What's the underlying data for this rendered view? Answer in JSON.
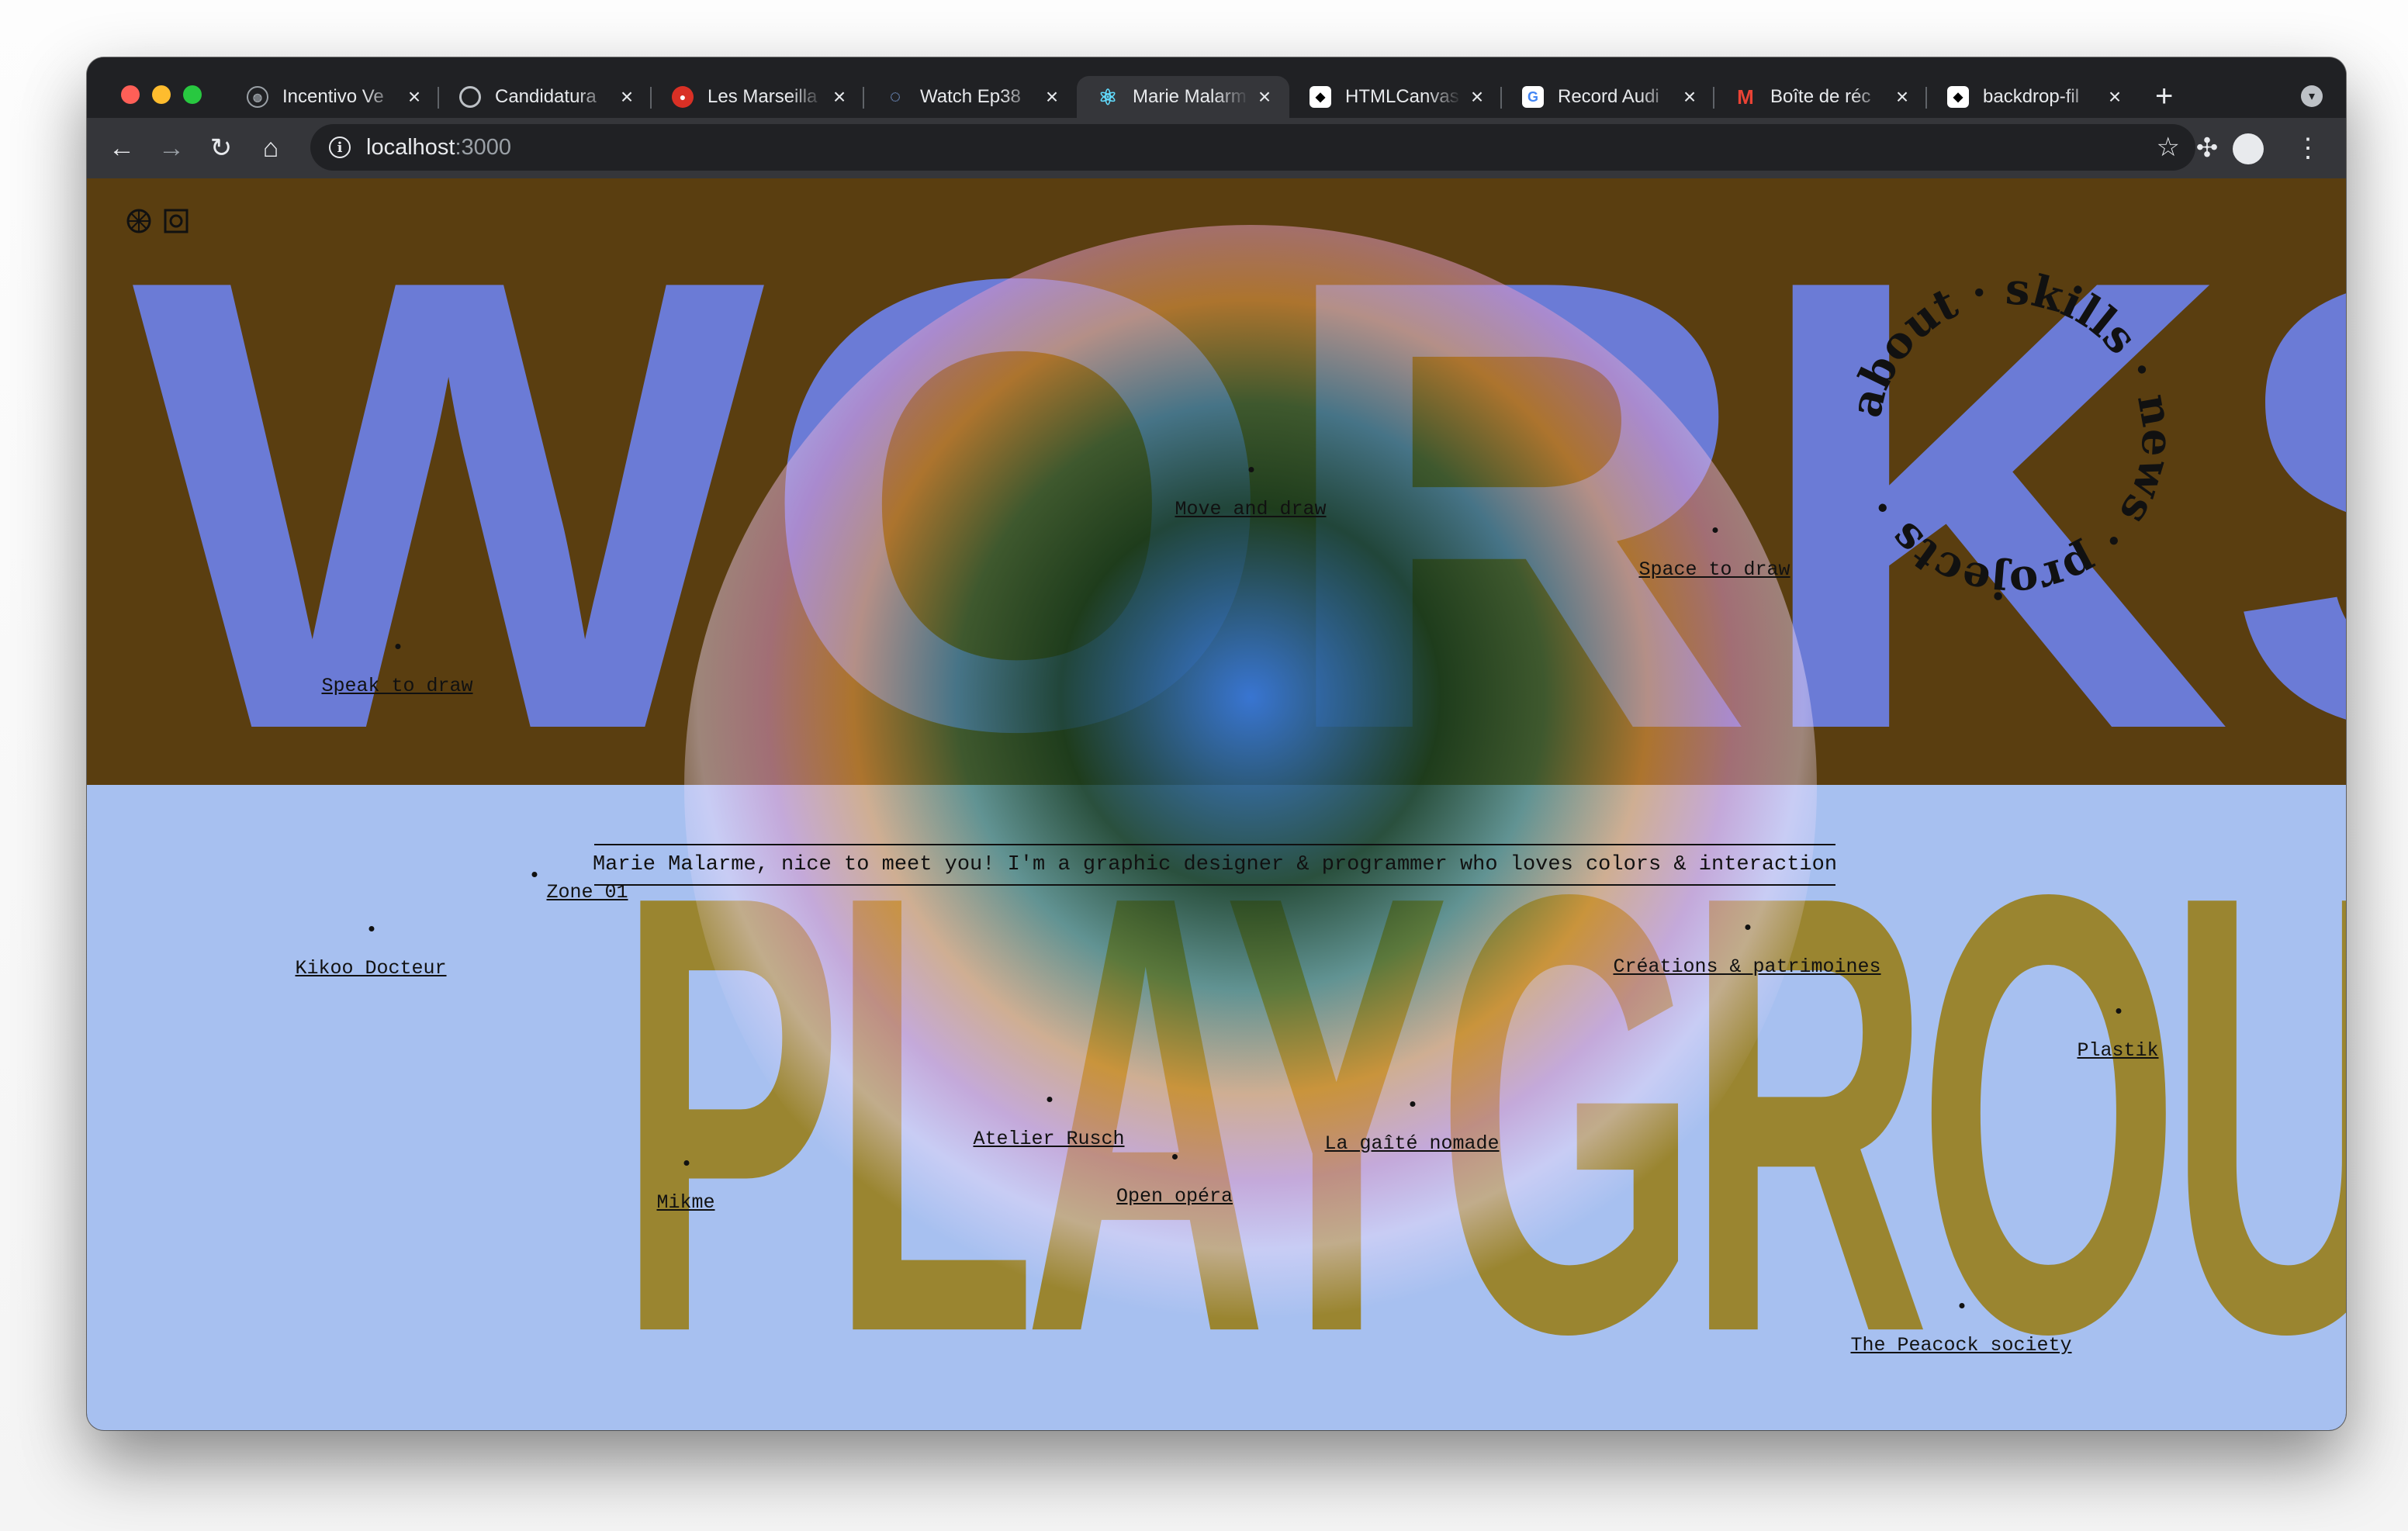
{
  "browser": {
    "tabs": [
      {
        "title": "Incentivo Ve",
        "favicon": "globe-icon",
        "active": false
      },
      {
        "title": "Candidatura",
        "favicon": "app-icon",
        "active": false
      },
      {
        "title": "Les Marseilla",
        "favicon": "record-icon",
        "active": false
      },
      {
        "title": "Watch Ep38",
        "favicon": "spinner-icon",
        "active": false
      },
      {
        "title": "Marie Malarm",
        "favicon": "react-icon",
        "active": true
      },
      {
        "title": "HTMLCanvas",
        "favicon": "mdn-icon",
        "active": false
      },
      {
        "title": "Record Audi",
        "favicon": "google-icon",
        "active": false
      },
      {
        "title": "Boîte de réc",
        "favicon": "gmail-icon",
        "active": false
      },
      {
        "title": "backdrop-fil",
        "favicon": "mdn-icon",
        "active": false
      }
    ],
    "url_host": "localhost",
    "url_port": ":3000",
    "colors": {
      "chrome_dark": "#202124",
      "chrome_toolbar": "#35363a"
    }
  },
  "page": {
    "headline_top": "WORKS",
    "headline_bottom": "PLAYGROUND",
    "tagline": "Marie Malarme, nice to meet you! I'm a graphic designer & programmer who loves colors & interaction",
    "nav_circle": "about · skills · news · projects ·",
    "works_links": [
      {
        "label": "Speak to draw"
      },
      {
        "label": "Move and draw"
      },
      {
        "label": "Space to draw"
      }
    ],
    "playground_links": [
      {
        "label": "Zone 01"
      },
      {
        "label": "Kikoo Docteur"
      },
      {
        "label": "Créations & patrimoines"
      },
      {
        "label": "Plastik"
      },
      {
        "label": "Atelier Rusch"
      },
      {
        "label": "La gaîté nomade"
      },
      {
        "label": "Mikme"
      },
      {
        "label": "Open opéra"
      },
      {
        "label": "The Peacock society"
      }
    ],
    "colors": {
      "works_bg": "#5a3e10",
      "works_text": "#6b7bd6",
      "playground_bg": "#a7c0f0",
      "playground_text": "#9a8530"
    }
  }
}
